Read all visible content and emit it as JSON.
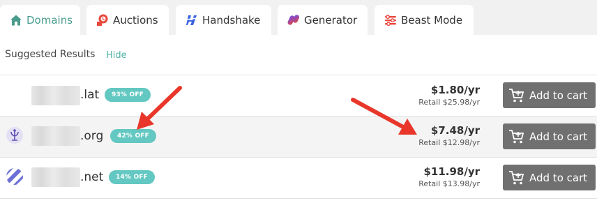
{
  "tabs": [
    {
      "label": "Domains",
      "icon": "home-icon",
      "active": true
    },
    {
      "label": "Auctions",
      "icon": "auction-gavel-icon",
      "active": false
    },
    {
      "label": "Handshake",
      "icon": "handshake-icon",
      "active": false
    },
    {
      "label": "Generator",
      "icon": "generator-icon",
      "active": false
    },
    {
      "label": "Beast Mode",
      "icon": "sliders-icon",
      "active": false
    }
  ],
  "suggested": {
    "title": "Suggested Results",
    "hide_label": "Hide"
  },
  "results": [
    {
      "tld": ".lat",
      "discount": "93% OFF",
      "price": "$1.80/yr",
      "retail": "Retail $25.98/yr",
      "cart_label": "Add to cart",
      "favicon": "none"
    },
    {
      "tld": ".org",
      "discount": "42% OFF",
      "price": "$7.48/yr",
      "retail": "Retail $12.98/yr",
      "cart_label": "Add to cart",
      "favicon": "org-favicon-icon"
    },
    {
      "tld": ".net",
      "discount": "14% OFF",
      "price": "$11.98/yr",
      "retail": "Retail $13.98/yr",
      "cart_label": "Add to cart",
      "favicon": "net-favicon-icon"
    }
  ],
  "colors": {
    "accent_teal": "#4a9c8c",
    "badge": "#63c8c1",
    "button": "#707070",
    "arrow": "#e8372a",
    "auction_red": "#e8473c",
    "handshake_blue": "#3a62e0",
    "generator_gradient": [
      "#6a4cf0",
      "#e8473c"
    ],
    "beast_red": "#e8473c"
  },
  "annotations": [
    {
      "type": "arrow",
      "points_to": "badge-42"
    },
    {
      "type": "arrow",
      "points_to": "price-7.48"
    }
  ]
}
